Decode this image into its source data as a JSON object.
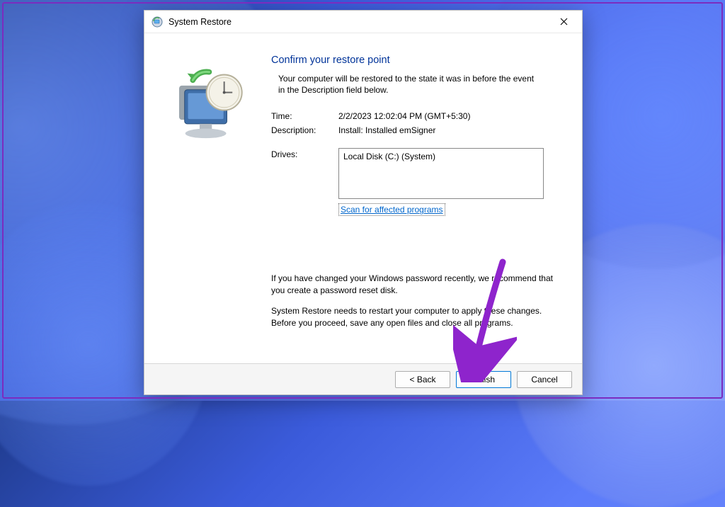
{
  "window": {
    "title": "System Restore"
  },
  "page": {
    "heading": "Confirm your restore point",
    "description": "Your computer will be restored to the state it was in before the event in the Description field below.",
    "time_label": "Time:",
    "time_value": "2/2/2023 12:02:04 PM (GMT+5:30)",
    "desc_label": "Description:",
    "desc_value": "Install: Installed emSigner",
    "drives_label": "Drives:",
    "drives_value": "Local Disk (C:) (System)",
    "scan_link": "Scan for affected programs",
    "note1": "If you have changed your Windows password recently, we recommend that you create a password reset disk.",
    "note2": "System Restore needs to restart your computer to apply these changes. Before you proceed, save any open files and close all programs."
  },
  "buttons": {
    "back": "< Back",
    "finish": "Finish",
    "cancel": "Cancel"
  },
  "colors": {
    "accent": "#0078d7",
    "annotation": "#8E24CC"
  }
}
